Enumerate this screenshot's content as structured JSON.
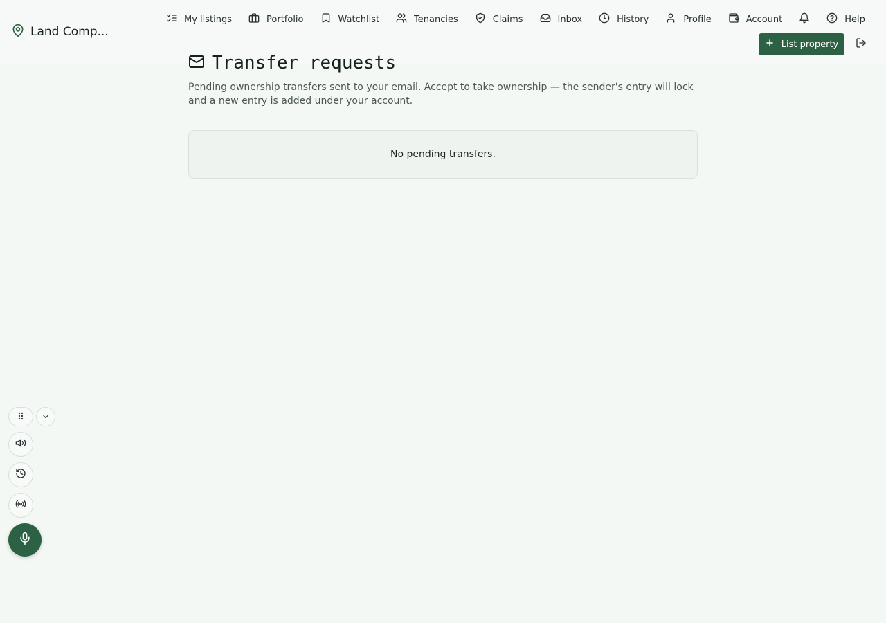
{
  "app": {
    "name": "Land Comp..."
  },
  "nav": [
    {
      "label": "My listings",
      "icon": "list-checks-icon"
    },
    {
      "label": "Portfolio",
      "icon": "briefcase-icon"
    },
    {
      "label": "Watchlist",
      "icon": "bookmark-icon"
    },
    {
      "label": "Tenancies",
      "icon": "users-icon"
    },
    {
      "label": "Claims",
      "icon": "shield-check-icon"
    },
    {
      "label": "Inbox",
      "icon": "inbox-icon"
    },
    {
      "label": "History",
      "icon": "clock-icon"
    },
    {
      "label": "Profile",
      "icon": "user-icon"
    },
    {
      "label": "Account",
      "icon": "wallet-icon"
    },
    {
      "label": "Help",
      "icon": "help-circle-icon"
    }
  ],
  "actions": {
    "list_property": "List property"
  },
  "page": {
    "title": "Transfer requests",
    "subtitle": "Pending ownership transfers sent to your email. Accept to take ownership — the sender's entry will lock and a new entry is added under your account.",
    "empty_message": "No pending transfers."
  },
  "colors": {
    "accent": "#2c6143",
    "background": "#f4f8f5"
  }
}
